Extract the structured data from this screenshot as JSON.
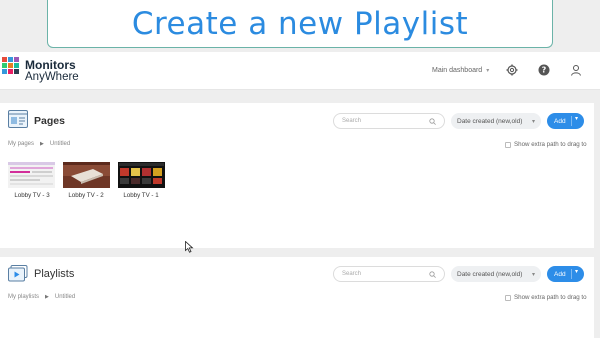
{
  "banner": {
    "title": "Create a new Playlist"
  },
  "header": {
    "logo_line1": "Monitors",
    "logo_line2": "AnyWhere",
    "dashboard_menu": "Main dashboard"
  },
  "pages": {
    "title": "Pages",
    "search_placeholder": "Search",
    "sort": "Date created (new,old)",
    "add": "Add",
    "breadcrumb": [
      "My pages",
      "Untitled"
    ],
    "extra_path": "Show extra path to drag to",
    "items": [
      {
        "label": "Lobby TV - 3"
      },
      {
        "label": "Lobby TV - 2"
      },
      {
        "label": "Lobby TV - 1"
      }
    ]
  },
  "playlists": {
    "title": "Playlists",
    "search_placeholder": "Search",
    "sort": "Date created (new,old)",
    "add": "Add",
    "breadcrumb": [
      "My playlists",
      "Untitled"
    ],
    "extra_path": "Show extra path to drag to"
  },
  "colors": {
    "accent": "#2d8de8",
    "banner_text": "#2b8be0",
    "banner_border": "#6bb3a8"
  }
}
